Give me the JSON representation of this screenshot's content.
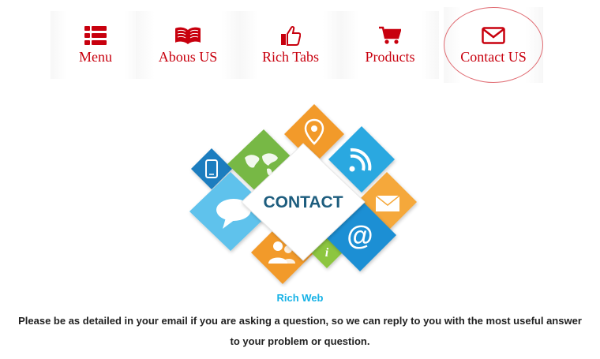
{
  "nav": {
    "items": [
      {
        "label": "Menu",
        "icon": "list-icon"
      },
      {
        "label": "Abous US",
        "icon": "book-icon"
      },
      {
        "label": "Rich Tabs",
        "icon": "thumbs-up-icon"
      },
      {
        "label": "Products",
        "icon": "shopping-cart-icon"
      },
      {
        "label": "Contact US",
        "icon": "envelope-icon",
        "active": true
      }
    ]
  },
  "hero": {
    "title": "CONTACT"
  },
  "content": {
    "brand": "Rich Web",
    "description": "Please be as detailed in your email if you are asking a question, so we can reply to you with the most useful answer to your problem or question."
  },
  "colors": {
    "nav_text": "#c8000e",
    "active_ring": "#e06b72",
    "brand_text": "#16b2e6",
    "body_text": "#222222"
  }
}
